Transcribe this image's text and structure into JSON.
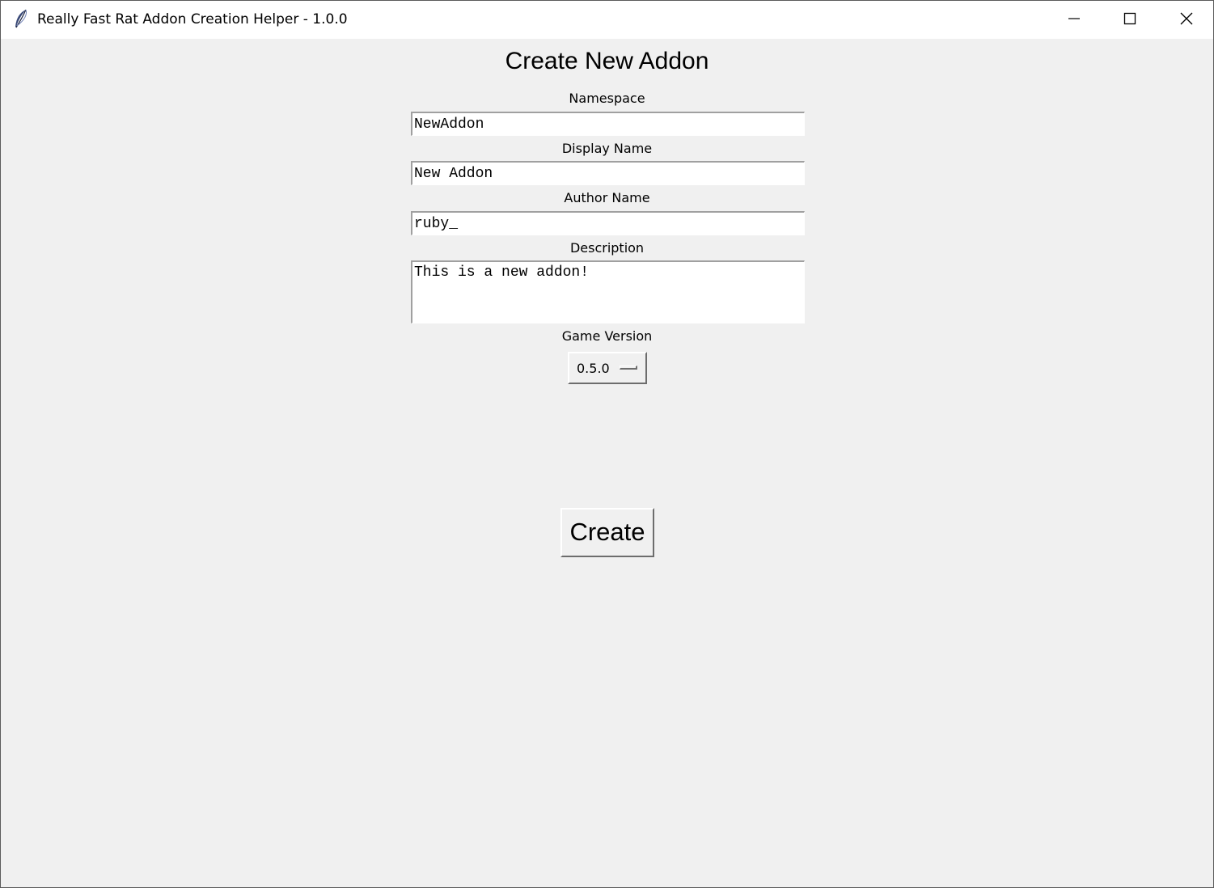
{
  "window": {
    "title": "Really Fast Rat Addon Creation Helper - 1.0.0",
    "app_icon": "feather-icon",
    "controls": {
      "minimize_icon": "minimize-icon",
      "maximize_icon": "maximize-icon",
      "close_icon": "close-icon"
    }
  },
  "form": {
    "heading": "Create New Addon",
    "namespace": {
      "label": "Namespace",
      "value": "NewAddon"
    },
    "display_name": {
      "label": "Display Name",
      "value": "New Addon"
    },
    "author_name": {
      "label": "Author Name",
      "value": "ruby_"
    },
    "description": {
      "label": "Description",
      "value": "This is a new addon!"
    },
    "game_version": {
      "label": "Game Version",
      "selected": "0.5.0"
    },
    "create_label": "Create"
  }
}
